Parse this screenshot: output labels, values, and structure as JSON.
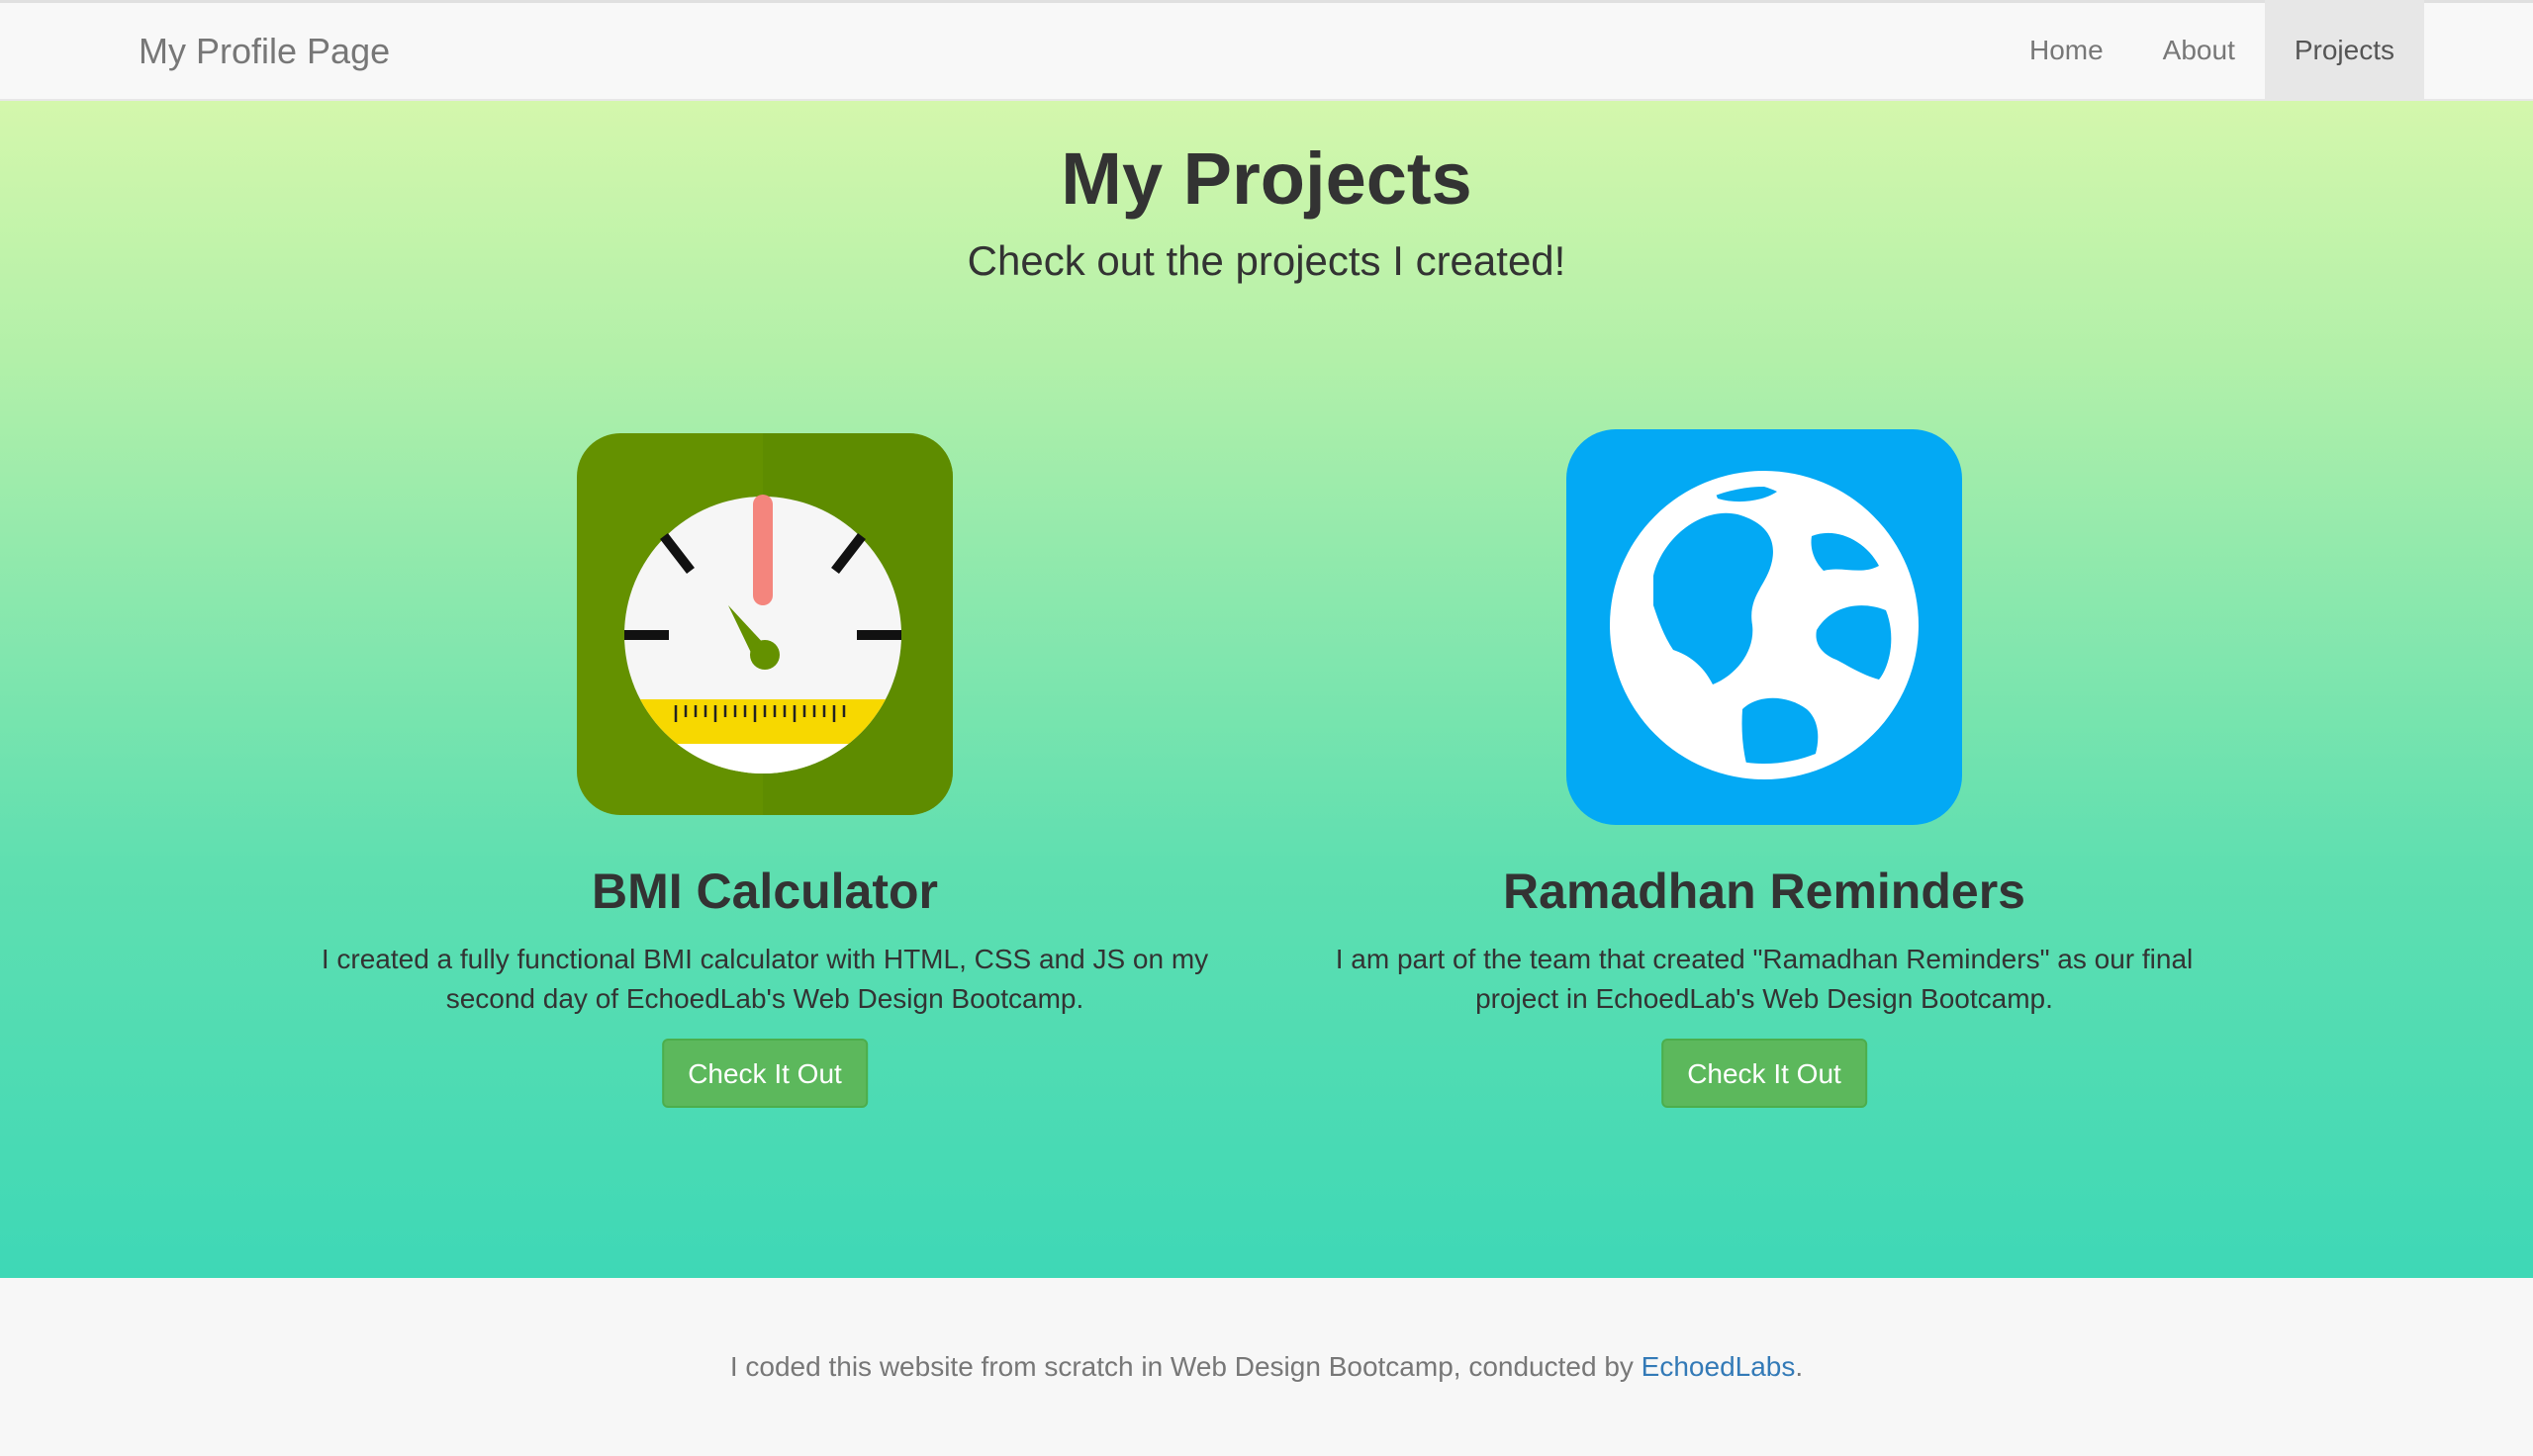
{
  "navbar": {
    "brand": "My Profile Page",
    "items": [
      {
        "label": "Home",
        "active": false
      },
      {
        "label": "About",
        "active": false
      },
      {
        "label": "Projects",
        "active": true
      }
    ]
  },
  "hero": {
    "title": "My Projects",
    "subtitle": "Check out the projects I created!"
  },
  "projects": [
    {
      "icon": "bmi-scale-icon",
      "title": "BMI Calculator",
      "description": "I created a fully functional BMI calculator with HTML, CSS and JS on my second day of EchoedLab's Web Design Bootcamp.",
      "button_label": "Check It Out"
    },
    {
      "icon": "globe-icon",
      "title": "Ramadhan Reminders",
      "description": "I am part of the team that created \"Ramadhan Reminders\" as our final project in EchoedLab's Web Design Bootcamp.",
      "button_label": "Check It Out"
    }
  ],
  "footer": {
    "text_before": "I coded this website from scratch in Web Design Bootcamp, conducted by ",
    "link_text": "EchoedLabs",
    "text_after": "."
  },
  "colors": {
    "button_green": "#5cb85c",
    "link_blue": "#337ab7",
    "bmi_icon_bg": "#649100",
    "globe_icon_bg": "#03a9f4",
    "gradient_top": "#d4f7ac",
    "gradient_bottom": "#3ed8b6"
  }
}
